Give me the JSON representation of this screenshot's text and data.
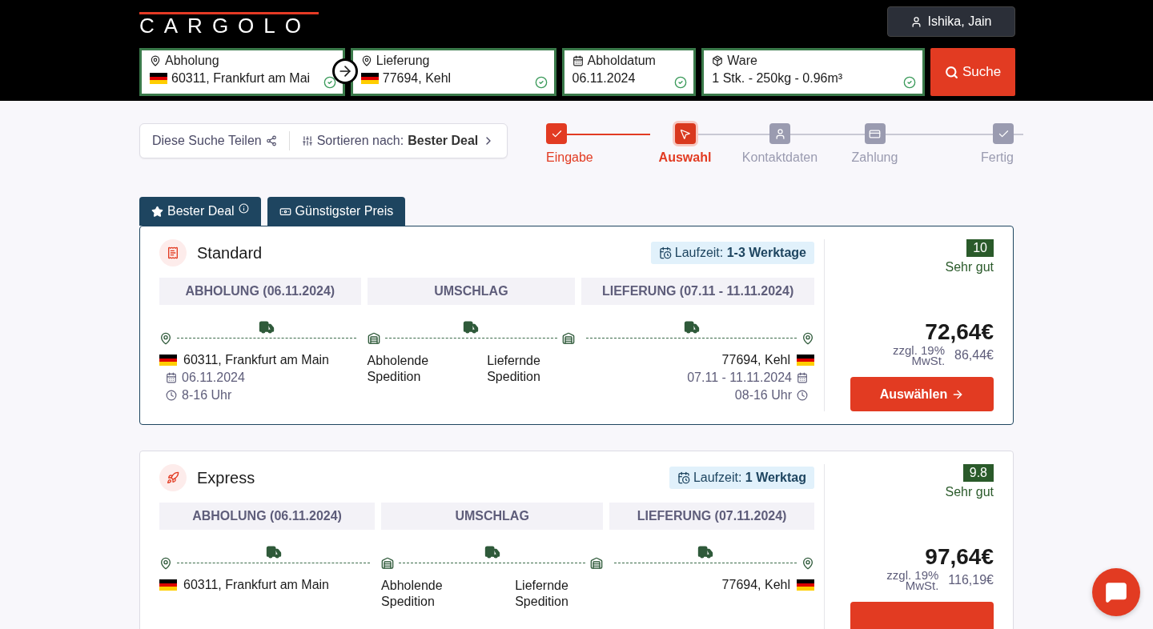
{
  "header": {
    "logo": "CARGOLO",
    "user": "Ishika, Jain"
  },
  "search": {
    "fields": [
      {
        "kind": "pickup",
        "label": "Abholung",
        "value": "60311, Frankfurt am Mai",
        "flag": true,
        "valid": true
      },
      {
        "kind": "delivery",
        "label": "Lieferung",
        "value": "77694, Kehl",
        "flag": true,
        "valid": true
      },
      {
        "kind": "date",
        "label": "Abholdatum",
        "value": "06.11.2024",
        "flag": false,
        "valid": true
      },
      {
        "kind": "goods",
        "label": "Ware",
        "value": "1 Stk. - 250kg - 0.96m³",
        "flag": false,
        "valid": true
      }
    ],
    "button": "Suche"
  },
  "toolbar": {
    "share": "Diese Suche Teilen",
    "sort_label": "Sortieren nach:",
    "sort_value": "Bester Deal"
  },
  "steps": [
    {
      "kind": "check",
      "label": "Eingabe",
      "done": true,
      "selected": false
    },
    {
      "kind": "cursor",
      "label": "Auswahl",
      "done": false,
      "selected": true
    },
    {
      "kind": "user",
      "label": "Kontaktdaten",
      "done": false,
      "selected": false
    },
    {
      "kind": "card",
      "label": "Zahlung",
      "done": false,
      "selected": false
    },
    {
      "kind": "check",
      "label": "Fertig",
      "done": false,
      "selected": false
    }
  ],
  "tabs": [
    {
      "kind": "star",
      "label": "Bester Deal",
      "info": true
    },
    {
      "kind": "money",
      "label": "Günstigster Preis",
      "info": false
    }
  ],
  "offers": [
    {
      "kind": "receipt",
      "name": "Standard",
      "selected": true,
      "transit_label": "Laufzeit:",
      "transit_value": "1-3 Werktage",
      "segments": [
        "ABHOLUNG (06.11.2024)",
        "UMSCHLAG",
        "LIEFERUNG (07.11 - 11.11.2024)"
      ],
      "origin": {
        "city": "60311, Frankfurt am Main",
        "date": "06.11.2024",
        "time": "8-16 Uhr"
      },
      "hubs": [
        "Abholende Spedition",
        "Liefernde Spedition"
      ],
      "destination": {
        "city": "77694, Kehl",
        "date": "07.11 - 11.11.2024",
        "time": "08-16 Uhr"
      },
      "score": "10",
      "rating": "Sehr gut",
      "price": "72,64€",
      "vat": "zzgl. 19% MwSt.",
      "gross": "86,44€",
      "button": "Auswählen"
    },
    {
      "kind": "rocket",
      "name": "Express",
      "selected": false,
      "transit_label": "Laufzeit:",
      "transit_value": "1 Werktag",
      "segments": [
        "ABHOLUNG (06.11.2024)",
        "UMSCHLAG",
        "LIEFERUNG (07.11.2024)"
      ],
      "origin": {
        "city": "60311, Frankfurt am Main"
      },
      "hubs": [
        "Abholende Spedition",
        "Liefernde Spedition"
      ],
      "destination": {
        "city": "77694, Kehl"
      },
      "score": "9.8",
      "rating": "Sehr gut",
      "price": "97,64€",
      "vat": "zzgl. 19% MwSt.",
      "gross": "116,19€"
    }
  ]
}
